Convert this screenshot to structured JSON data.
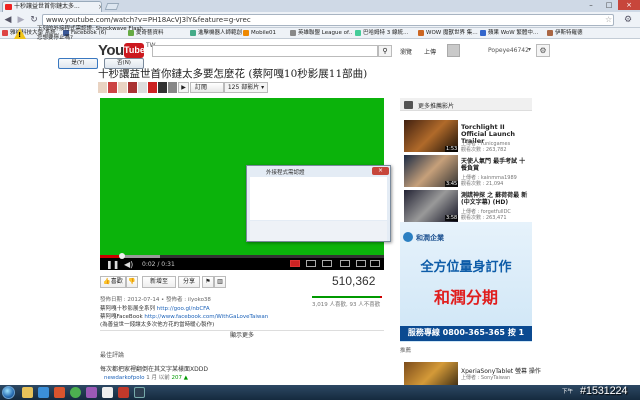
{
  "browser": {
    "tab_title": "十秒讓益世首你鏈太多...",
    "tab_close": "×",
    "url": "www.youtube.com/watch?v=PH18AcVJ3lY&feature=g-vrec",
    "window_min": "–",
    "window_max": "□",
    "window_close": "×",
    "bookmarks": [
      {
        "label": "雅裕科技大學 系統…",
        "color": "#d44"
      },
      {
        "label": "Facebook (6)",
        "color": "#3b5998"
      },
      {
        "label": "愛奇藝資料",
        "color": "#6a4"
      },
      {
        "label": "進擊機器人師範創作",
        "color": "#4a8"
      },
      {
        "label": "Mobile01",
        "color": "#e80"
      },
      {
        "label": "英雄聯盟 League of…",
        "color": "#888"
      },
      {
        "label": "巴哈姆特 3 線統…",
        "color": "#4c9"
      },
      {
        "label": "WOW 魔獸世界 集…",
        "color": "#c62"
      },
      {
        "label": "蘋果 WoW 繁體中…",
        "color": "#36c"
      },
      {
        "label": "伊斯特羅德",
        "color": "#a64"
      }
    ]
  },
  "youtube": {
    "logo_you": "You",
    "logo_tube": "Tube",
    "region": "TW",
    "search_icon": "search-icon",
    "browse": "瀏覽",
    "upload": "上傳",
    "username": "Popeye4674​2",
    "user_arrow": "▾",
    "settings": "⚙"
  },
  "video": {
    "title": "十秒讓益世首你鏈太多要怎麼花 (蔡阿嘎10秒影展11部曲)",
    "subscribe": "訂閱",
    "video_count": "125 部影片 ▾",
    "play_icon": "▶"
  },
  "player": {
    "time": "0:02 / 0:31",
    "play_glyph": "❚❚",
    "volume_glyph": "◀)"
  },
  "dialog": {
    "title": "外接程式需認證",
    "message_line1": "下列的外接程式需認證: Shockwave Flash",
    "message_line2": "您想要停止嗎?",
    "yes": "是(Y)",
    "no": "否(N)",
    "close": "×",
    "warn_mark": "!"
  },
  "actions": {
    "like": "喜歡",
    "add": "新增至",
    "share": "分享",
    "views": "510,362",
    "like_ratio": 0.97,
    "like_stats": "3,019 人喜歡, 93 人不喜歡",
    "publish": "發佈日期 : 2012-07-14 • 發佈者 : ilyoko38",
    "desc1_text": "蔡阿嘎十秒影展全系列 ",
    "desc1_link": "http://goo.gl/nbCFA",
    "desc2_text": "蔡阿嘎FaceBook ",
    "desc2_link": "http://www.facebook.com/WithGaLoveTaiwan",
    "desc3": "(為善益世一錢讓太多次他方花的當時暖心製作)",
    "show_more": "顯示更多",
    "comments_heading": "最佳評論",
    "comment": "每次都把家裡翻倒在其文字某樣面XDDD",
    "comment_user": "newdarkofpolo",
    "comment_time": "1 月 以前",
    "comment_likes": "207 ▲"
  },
  "sidebar": {
    "header": "更多推薦影片",
    "related": [
      {
        "title": "Torchlight II Official Launch Trailer",
        "by": "上傳者 : runicgames",
        "views": "觀看次數 : 263,782",
        "duration": "1:53"
      },
      {
        "title": "天使人氣門 最手考試 十餐負賞",
        "by": "上傳者 : kainmma1989",
        "views": "觀看次數 : 21,094",
        "duration": "3:45"
      },
      {
        "title": "測謊神探 之 蘇荷荷最 新 (中文字幕) (HD)",
        "by": "上傳者 : forgetfullDC",
        "views": "觀看次數 : 263,471",
        "duration": "3:58"
      }
    ],
    "ad_logo": "和潤企業",
    "ad_line1": "全方位量身訂作",
    "ad_line2": "和潤分期",
    "ad_hotline": "服務專線 0800-365-365 按 1",
    "ad_label": "推薦",
    "rel4_title": "XperiaSonyTablet 螢幕 操作",
    "rel4_by": "上傳者 : SonyTaiwan"
  },
  "taskbar": {
    "time": "下午",
    "watermark": "#1531224"
  }
}
